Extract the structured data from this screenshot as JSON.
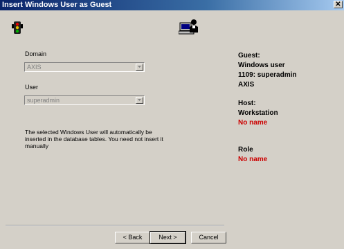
{
  "window": {
    "title": "Insert Windows User as Guest",
    "close": "✕"
  },
  "icons": {
    "left": "traffic-light-icon",
    "center": "user-computer-icon"
  },
  "domain": {
    "label": "Domain",
    "value": "AXIS"
  },
  "user": {
    "label": "User",
    "value": "superadmin"
  },
  "info_lines": [
    "The selected Windows User will automatically be",
    "inserted in the database tables. You need not insert it",
    "manually"
  ],
  "right_panel": {
    "guest_label": "Guest:",
    "guest_type": "Windows user",
    "guest_id": "1109: superadmin",
    "guest_domain": "AXIS",
    "host_label": "Host:",
    "host_type": "Workstation",
    "host_value": "No name",
    "role_label": "Role",
    "role_value": "No name",
    "alert_color": "#cc0000"
  },
  "buttons": {
    "back": "< Back",
    "next": "Next >",
    "cancel": "Cancel"
  }
}
